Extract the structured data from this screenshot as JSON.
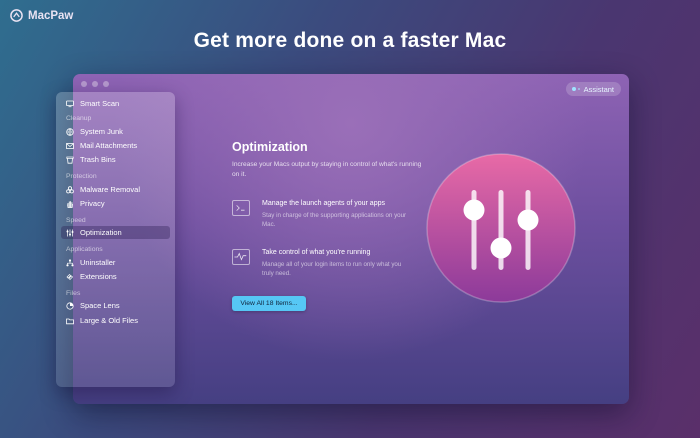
{
  "brand": {
    "name": "MacPaw",
    "icon": "macpaw-logo-icon"
  },
  "headline": "Get more done on a faster Mac",
  "window": {
    "assistant_label": "Assistant"
  },
  "sidebar": {
    "top_item": {
      "label": "Smart Scan",
      "icon": "monitor-icon"
    },
    "sections": [
      {
        "heading": "Cleanup",
        "items": [
          {
            "label": "System Junk",
            "icon": "globe-icon"
          },
          {
            "label": "Mail Attachments",
            "icon": "mail-icon"
          },
          {
            "label": "Trash Bins",
            "icon": "trash-icon"
          }
        ]
      },
      {
        "heading": "Protection",
        "items": [
          {
            "label": "Malware Removal",
            "icon": "biohazard-icon"
          },
          {
            "label": "Privacy",
            "icon": "hand-icon"
          }
        ]
      },
      {
        "heading": "Speed",
        "items": [
          {
            "label": "Optimization",
            "icon": "sliders-icon",
            "active": true
          }
        ]
      },
      {
        "heading": "Applications",
        "items": [
          {
            "label": "Uninstaller",
            "icon": "network-icon"
          },
          {
            "label": "Extensions",
            "icon": "extensions-icon"
          }
        ]
      },
      {
        "heading": "Files",
        "items": [
          {
            "label": "Space Lens",
            "icon": "lens-icon"
          },
          {
            "label": "Large & Old Files",
            "icon": "folder-icon"
          }
        ]
      }
    ]
  },
  "optimization": {
    "title": "Optimization",
    "description": "Increase your Macs output by staying in control of what's running on it.",
    "features": [
      {
        "title": "Manage the launch agents of your apps",
        "text": "Stay in charge of the supporting applications on your Mac.",
        "icon": "launch-agents-icon"
      },
      {
        "title": "Take control of what you're running",
        "text": "Manage all of your login items to run only what you truly need.",
        "icon": "activity-monitor-icon"
      }
    ],
    "button_label": "View All 18 Items..."
  },
  "colors": {
    "accent_button": "#56c7f5",
    "hero_gradient_top": "#e86aa6",
    "hero_gradient_bottom": "#8c3a9a"
  }
}
